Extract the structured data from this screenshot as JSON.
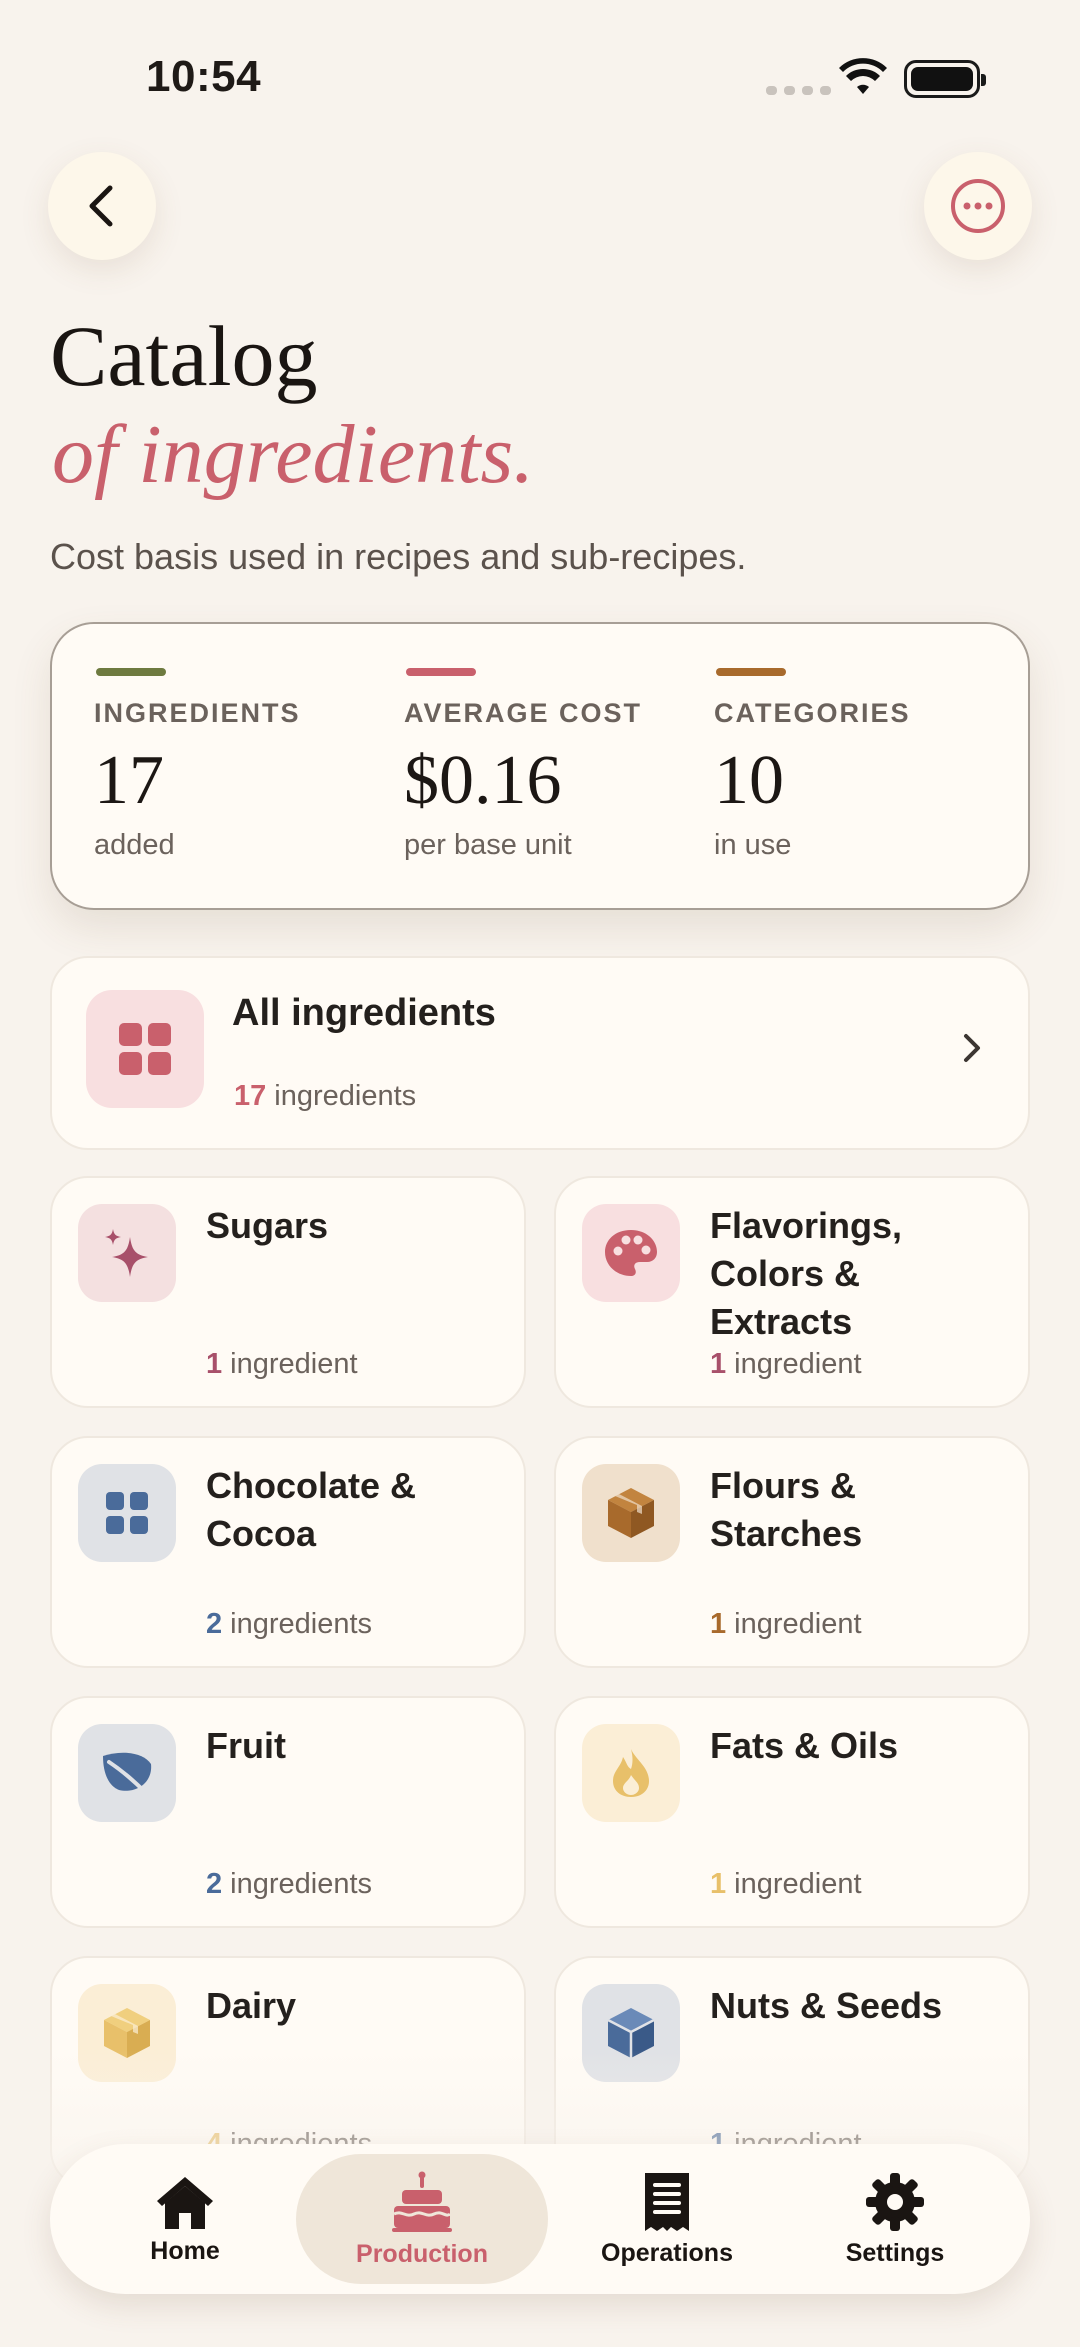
{
  "status_bar": {
    "time": "10:54"
  },
  "header": {
    "title": "Catalog",
    "subtitle": "of ingredients.",
    "description": "Cost basis used in recipes and sub-recipes."
  },
  "stats": [
    {
      "label": "INGREDIENTS",
      "value": "17",
      "sub": "added",
      "color": "#6e7a3f"
    },
    {
      "label": "AVERAGE COST",
      "value": "$0.16",
      "sub": "per base unit",
      "color": "#c9606c"
    },
    {
      "label": "CATEGORIES",
      "value": "10",
      "sub": "in use",
      "color": "#a86a2c"
    }
  ],
  "all_ingredients": {
    "title": "All ingredients",
    "count": "17",
    "unit": "ingredients",
    "icon": "grid-icon",
    "tile_color": "#f8dfe0",
    "accent": "#c9606c"
  },
  "categories": [
    {
      "name": "Sugars",
      "count": "1",
      "unit": "ingredient",
      "icon": "sparkle-icon",
      "tile_color": "#f4e0e0",
      "accent": "#a8506a"
    },
    {
      "name": "Flavorings, Colors & Extracts",
      "count": "1",
      "unit": "ingredient",
      "icon": "palette-icon",
      "tile_color": "#f8dfe0",
      "accent": "#c9606c"
    },
    {
      "name": "Chocolate & Cocoa",
      "count": "2",
      "unit": "ingredients",
      "icon": "grid-icon",
      "tile_color": "#e0e2e6",
      "accent": "#4a6b9a"
    },
    {
      "name": "Flours & Starches",
      "count": "1",
      "unit": "ingredient",
      "icon": "box-icon",
      "tile_color": "#f0e0cc",
      "accent": "#a86a2c"
    },
    {
      "name": "Fruit",
      "count": "2",
      "unit": "ingredients",
      "icon": "leaf-icon",
      "tile_color": "#e0e2e6",
      "accent": "#4a6b9a"
    },
    {
      "name": "Fats & Oils",
      "count": "1",
      "unit": "ingredient",
      "icon": "flame-icon",
      "tile_color": "#fbeed6",
      "accent": "#e8c06a"
    },
    {
      "name": "Dairy",
      "count": "4",
      "unit": "ingredients",
      "icon": "box-icon",
      "tile_color": "#fbeed6",
      "accent": "#e8c06a"
    },
    {
      "name": "Nuts & Seeds",
      "count": "1",
      "unit": "ingredient",
      "icon": "cube-icon",
      "tile_color": "#e0e2e6",
      "accent": "#4a6b9a"
    }
  ],
  "tabbar": [
    {
      "label": "Home",
      "icon": "home-icon",
      "active": false
    },
    {
      "label": "Production",
      "icon": "cake-icon",
      "active": true
    },
    {
      "label": "Operations",
      "icon": "receipt-icon",
      "active": false
    },
    {
      "label": "Settings",
      "icon": "gear-icon",
      "active": false
    }
  ]
}
